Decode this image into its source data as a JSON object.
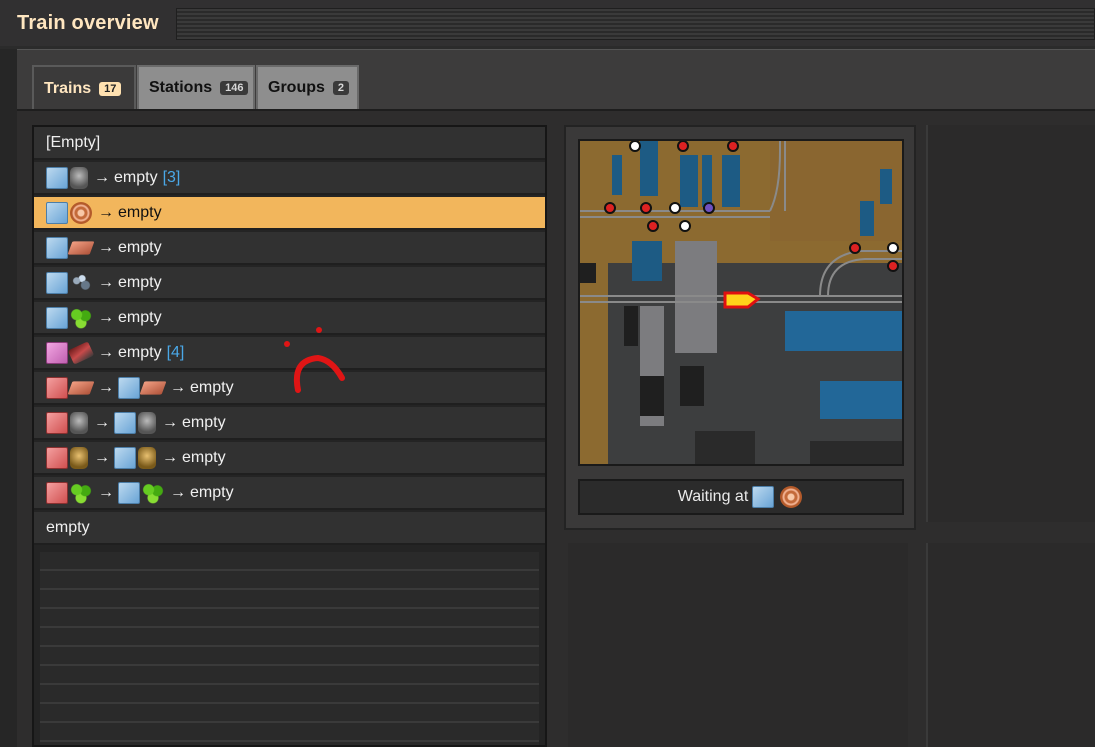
{
  "window": {
    "title": "Train overview"
  },
  "tabs": [
    {
      "label": "Trains",
      "count": "17"
    },
    {
      "label": "Stations",
      "count": "146"
    },
    {
      "label": "Groups",
      "count": "2"
    }
  ],
  "trains": [
    {
      "text": "[Empty]"
    },
    {
      "dest": "empty",
      "count": "[3]"
    },
    {
      "dest": "empty"
    },
    {
      "dest": "empty"
    },
    {
      "dest": "empty"
    },
    {
      "dest": "empty"
    },
    {
      "dest": "empty",
      "count": "[4]"
    },
    {
      "dest": "empty"
    },
    {
      "dest": "empty"
    },
    {
      "dest": "empty"
    },
    {
      "dest": "empty"
    },
    {
      "text": "empty"
    }
  ],
  "arrow": "→",
  "status": {
    "label": "Waiting at"
  },
  "icons": [
    "blue-station-icon",
    "barrel-icon",
    "copper-coil-icon",
    "copper-plate-icon",
    "iron-ore-icon",
    "green-circuit-icon",
    "locomotive-icon",
    "pink-station-icon",
    "red-station-icon"
  ],
  "colors": {
    "selected": "#f2b65c",
    "accent_count": "#4aa8e8",
    "title": "#ffe6c0"
  }
}
